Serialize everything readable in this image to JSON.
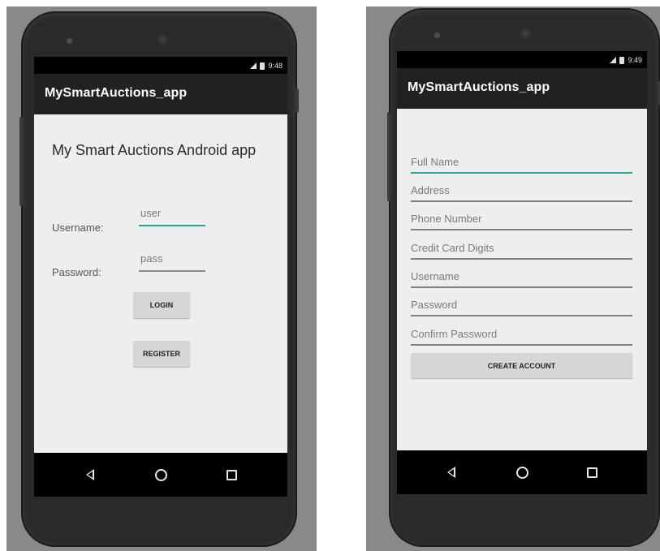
{
  "left_phone": {
    "status_time": "9:48",
    "app_title": "MySmartAuctions_app",
    "heading": "My Smart Auctions Android app",
    "username_label": "Username:",
    "username_value": "user",
    "password_label": "Password:",
    "password_value": "pass",
    "login_button": "LOGIN",
    "register_button": "REGISTER"
  },
  "right_phone": {
    "status_time": "9:49",
    "app_title": "MySmartAuctions_app",
    "fields": [
      "Full Name",
      "Address",
      "Phone Number",
      "Credit Card Digits",
      "Username",
      "Password",
      "Confirm Password"
    ],
    "create_button": "CREATE ACCOUNT"
  },
  "navbar_icons": [
    "back-icon",
    "home-icon",
    "recents-icon"
  ],
  "colors": {
    "accent": "#2aa396",
    "appbar": "#212121",
    "screen_bg": "#eeeeee",
    "button_bg": "#d6d6d6"
  }
}
